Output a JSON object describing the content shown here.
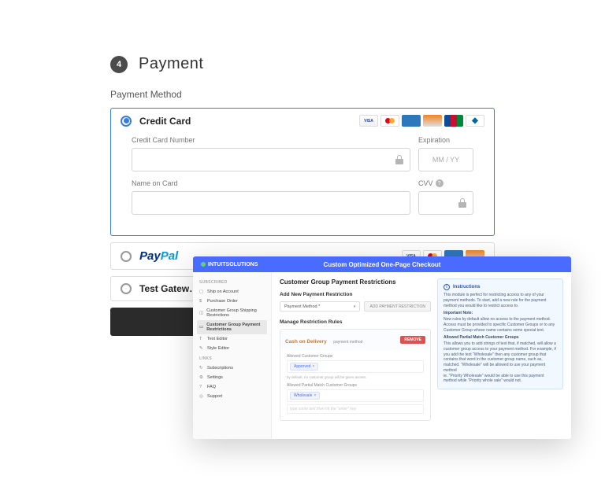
{
  "checkout": {
    "step_num": "4",
    "step_title": "Payment",
    "method_label": "Payment Method",
    "options": [
      {
        "name": "Credit Card",
        "selected": true
      },
      {
        "name": "PayPal",
        "selected": false
      },
      {
        "name": "Test Gatew…",
        "selected": false
      }
    ],
    "card_brands": [
      "VISA",
      "MC",
      "AMEX",
      "DISCOVER",
      "JCB",
      "DINERS"
    ],
    "card_brands_pp": [
      "VISA",
      "MC",
      "AMEX",
      "DISCOVER"
    ],
    "cc": {
      "number_label": "Credit Card Number",
      "exp_label": "Expiration",
      "exp_placeholder": "MM / YY",
      "name_label": "Name on Card",
      "cvv_label": "CVV"
    }
  },
  "admin": {
    "brand": "INTUITSOLUTIONS",
    "title": "Custom Optimized One-Page Checkout",
    "sidebar": {
      "group1_label": "SUBSCRIBED",
      "items1": [
        "Ship on Account",
        "Purchase Order",
        "Customer Group Shipping Restrictions",
        "Customer Group Payment Restrictions",
        "Text Editor",
        "Style Editor"
      ],
      "active_index": 3,
      "group2_label": "LINKS",
      "items2": [
        "Subscriptions",
        "Settings",
        "FAQ",
        "Support"
      ]
    },
    "main": {
      "heading": "Customer Group Payment Restrictions",
      "add_label": "Add New Payment Restriction",
      "dropdown_label": "Payment Method *",
      "add_btn": "ADD PAYMENT RESTRICTION",
      "rules_heading": "Manage Restriction Rules",
      "rule": {
        "name": "Cash on Delivery",
        "tag": "payment method",
        "remove": "REMOVE",
        "allowed_label": "Allowed Customer Groups",
        "allowed_chip": "Approved",
        "default_note": "by default, no customer group will be given access",
        "partial_label": "Allowed Partial Match Customer Groups",
        "partial_chip": "Wholesale",
        "input_placeholder": "type some text then hit the \"enter\" key"
      }
    },
    "instructions": {
      "title": "Instructions",
      "p1": "This module is perfect for restricting access to any of your payment methods. To start, add a new rule for the payment method you would like to restrict access to.",
      "sub1": "Important Note:",
      "p2": "New rules by default allow no access to the payment method. Access must be provided to specific Customer Groups or to any Customer Group whose name contains some special text.",
      "sub2": "Allowed Partial Match Customer Groups",
      "p3": "This allows you to add strings of text that, if matched, will allow a customer group access to your payment method. For example, if you add the text \"Wholesale\" then any customer group that contains that word in the customer group name, such as, matched. \"Wholesale\" will be allowed to use your payment method",
      "p4": "ie. \"Priority Wholesale\" would be able to use this payment method while \"Priority whole sale\" would not."
    }
  }
}
